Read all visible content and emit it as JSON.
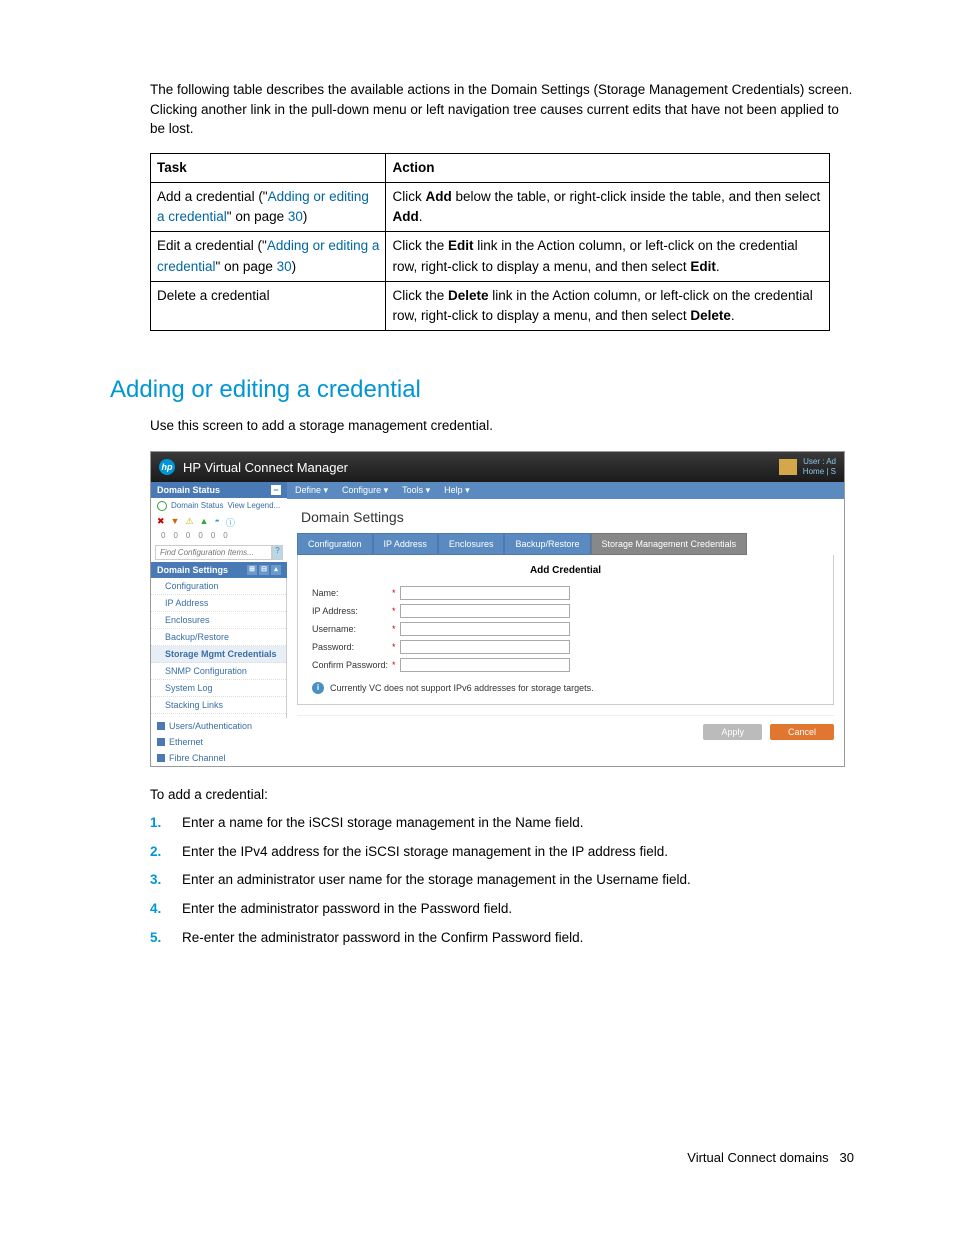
{
  "intro": "The following table describes the available actions in the Domain Settings (Storage Management Credentials) screen. Clicking another link in the pull-down menu or left navigation tree causes current edits that have not been applied to be lost.",
  "table": {
    "headers": {
      "task": "Task",
      "action": "Action"
    },
    "rows": [
      {
        "task_prefix": "Add a credential (\"",
        "task_link": "Adding or editing a credential",
        "task_suffix": "\" on page ",
        "task_page": "30",
        "task_close": ")",
        "action_pre": "Click ",
        "action_b1": "Add",
        "action_mid": " below the table, or right-click inside the table, and then select ",
        "action_b2": "Add",
        "action_post": "."
      },
      {
        "task_prefix": "Edit a credential (\"",
        "task_link": "Adding or editing a credential",
        "task_suffix": "\" on page ",
        "task_page": "30",
        "task_close": ")",
        "action_pre": "Click the ",
        "action_b1": "Edit",
        "action_mid": " link in the Action column, or left-click on the credential row, right-click to display a menu, and then select ",
        "action_b2": "Edit",
        "action_post": "."
      },
      {
        "task_plain": "Delete a credential",
        "action_pre": "Click the ",
        "action_b1": "Delete",
        "action_mid": " link in the Action column, or left-click on the credential row, right-click to display a menu, and then select ",
        "action_b2": "Delete",
        "action_post": "."
      }
    ]
  },
  "heading": "Adding or editing a credential",
  "heading_desc": "Use this screen to add a storage management credential.",
  "screenshot": {
    "titlebar": "HP Virtual Connect Manager",
    "user_line1": "User : Ad",
    "user_line2": "Home | S",
    "menu": [
      "Define ▾",
      "Configure ▾",
      "Tools ▾",
      "Help ▾"
    ],
    "sidebar": {
      "domain_status_hdr": "Domain Status",
      "domain_status_link": "Domain Status",
      "view_legend": "View Legend...",
      "counts": [
        "0",
        "0",
        "0",
        "0",
        "0",
        "0"
      ],
      "search_placeholder": "Find Configuration Items...",
      "settings_hdr": "Domain Settings",
      "items": [
        "Configuration",
        "IP Address",
        "Enclosures",
        "Backup/Restore",
        "Storage Mgmt Credentials",
        "SNMP Configuration",
        "System Log",
        "Stacking Links"
      ],
      "top_items": [
        "Users/Authentication",
        "Ethernet",
        "Fibre Channel"
      ]
    },
    "main": {
      "title": "Domain Settings",
      "tabs": [
        "Configuration",
        "IP Address",
        "Enclosures",
        "Backup/Restore",
        "Storage Management Credentials"
      ],
      "panel_title": "Add Credential",
      "fields": {
        "name": "Name:",
        "ip": "IP Address:",
        "user": "Username:",
        "pass": "Password:",
        "confirm": "Confirm Password:"
      },
      "info": "Currently VC does not support IPv6 addresses for storage targets.",
      "buttons": {
        "apply": "Apply",
        "cancel": "Cancel"
      }
    }
  },
  "add_intro": "To add a credential:",
  "steps": [
    "Enter a name for the iSCSI storage management in the Name field.",
    "Enter the IPv4 address for the iSCSI storage management in the IP address field.",
    "Enter an administrator user name for the storage management in the Username field.",
    "Enter the administrator password in the Password field.",
    "Re-enter the administrator password in the Confirm Password field."
  ],
  "footer": {
    "text": "Virtual Connect domains",
    "page": "30"
  }
}
